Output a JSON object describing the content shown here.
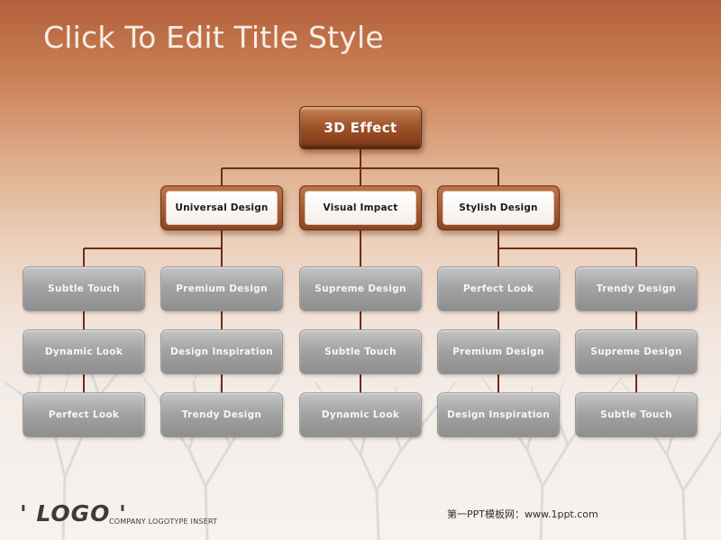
{
  "slide": {
    "title": "Click To Edit Title Style",
    "logo": "' LOGO '",
    "tagline": "COMPANY  LOGOTYPE  INSERT",
    "watermark": "第一PPT模板网：www.1ppt.com"
  },
  "org_chart": {
    "root": "3D Effect",
    "level1": [
      "Universal Design",
      "Visual Impact",
      "Stylish Design"
    ],
    "columns": [
      [
        "Subtle Touch",
        "Dynamic Look",
        "Perfect Look"
      ],
      [
        "Premium Design",
        "Design Inspiration",
        "Trendy Design"
      ],
      [
        "Supreme Design",
        "Subtle Touch",
        "Dynamic Look"
      ],
      [
        "Perfect Look",
        "Premium Design",
        "Design Inspiration"
      ],
      [
        "Trendy Design",
        "Supreme Design",
        "Subtle Touch"
      ]
    ],
    "column_parents": [
      "Universal Design",
      "Universal Design",
      "Visual Impact",
      "Stylish Design",
      "Stylish Design"
    ]
  },
  "colors": {
    "accent_brown": "#9e5028",
    "connector": "#6b2e14",
    "leaf_gray": "#a2a2a2"
  }
}
